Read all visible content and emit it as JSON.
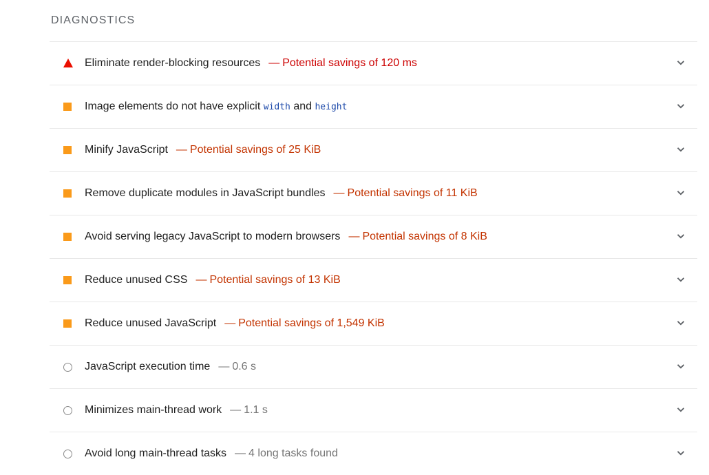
{
  "section": {
    "title": "DIAGNOSTICS"
  },
  "colors": {
    "fail": "#eb0f00",
    "average": "#fa9a1a",
    "info_icon": "#8a8a8a",
    "savings_fail": "#cc0000",
    "savings_average": "#c33300",
    "savings_info": "#757575",
    "code": "#1a47a8"
  },
  "audits": [
    {
      "status": "fail",
      "icon": "triangle-icon",
      "title": "Eliminate render-blocking resources",
      "separator": "—",
      "savings": "Potential savings of 120 ms"
    },
    {
      "status": "average",
      "icon": "square-icon",
      "title_prefix": "Image elements do not have explicit",
      "code1": "width",
      "title_and": "and",
      "code2": "height"
    },
    {
      "status": "average",
      "icon": "square-icon",
      "title": "Minify JavaScript",
      "separator": "—",
      "savings": "Potential savings of 25 KiB"
    },
    {
      "status": "average",
      "icon": "square-icon",
      "title": "Remove duplicate modules in JavaScript bundles",
      "separator": "—",
      "savings": "Potential savings of 11 KiB"
    },
    {
      "status": "average",
      "icon": "square-icon",
      "title": "Avoid serving legacy JavaScript to modern browsers",
      "separator": "—",
      "savings": "Potential savings of 8 KiB"
    },
    {
      "status": "average",
      "icon": "square-icon",
      "title": "Reduce unused CSS",
      "separator": "—",
      "savings": "Potential savings of 13 KiB"
    },
    {
      "status": "average",
      "icon": "square-icon",
      "title": "Reduce unused JavaScript",
      "separator": "—",
      "savings": "Potential savings of 1,549 KiB"
    },
    {
      "status": "info",
      "icon": "circle-icon",
      "title": "JavaScript execution time",
      "separator": "—",
      "savings": "0.6 s"
    },
    {
      "status": "info",
      "icon": "circle-icon",
      "title": "Minimizes main-thread work",
      "separator": "—",
      "savings": "1.1 s"
    },
    {
      "status": "info",
      "icon": "circle-icon",
      "title": "Avoid long main-thread tasks",
      "separator": "—",
      "savings": "4 long tasks found"
    }
  ]
}
